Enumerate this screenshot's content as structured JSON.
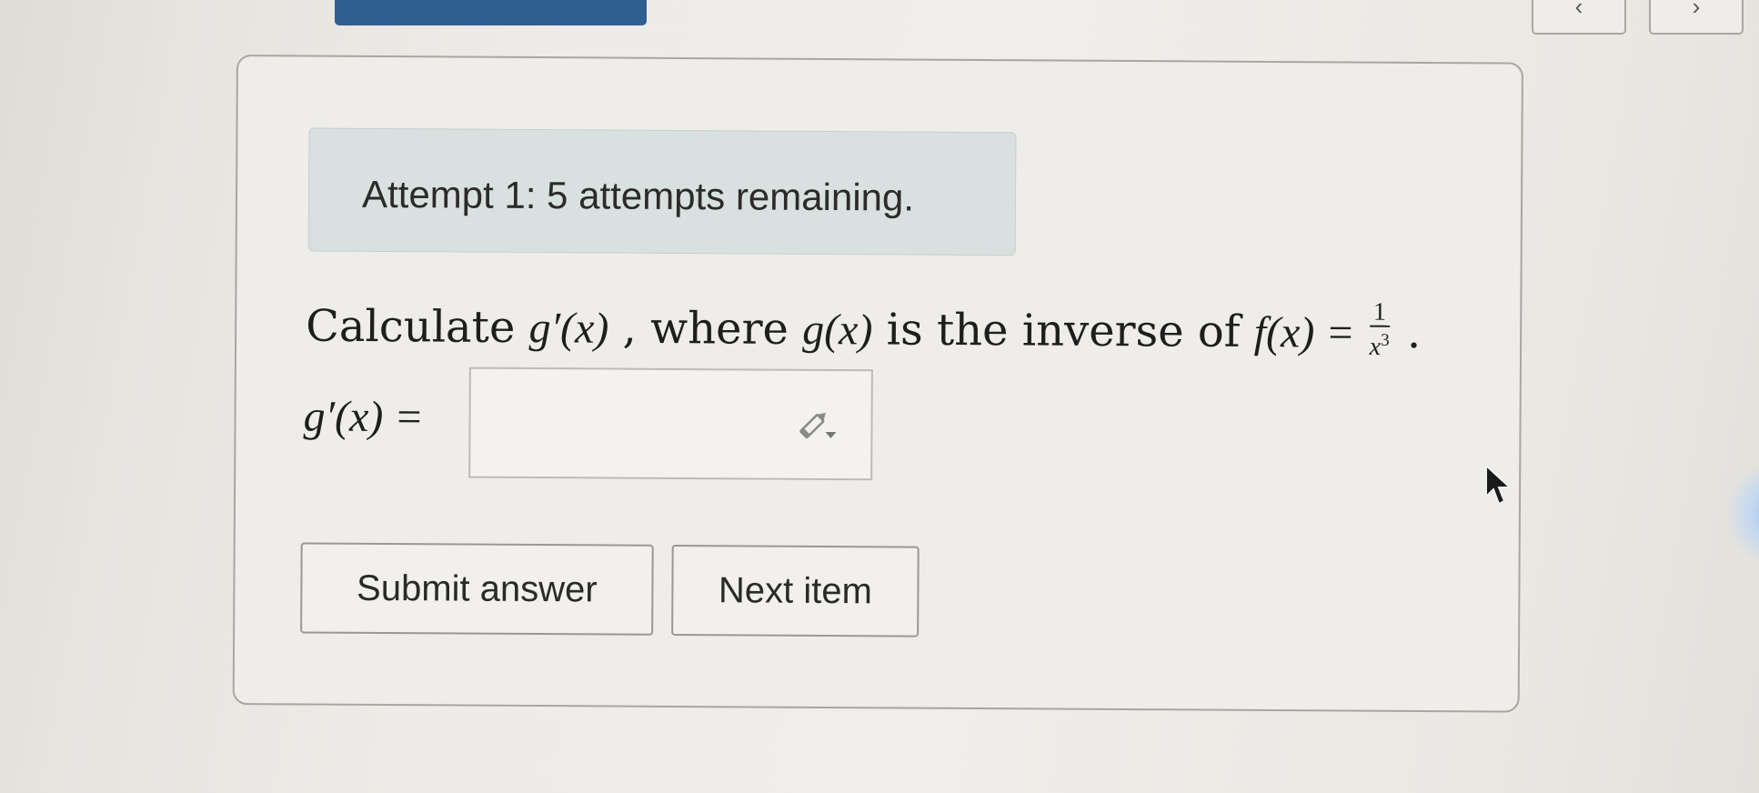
{
  "nav": {
    "prev_icon": "chevron-left-icon",
    "next_icon": "chevron-right-icon",
    "prev_glyph": "‹",
    "next_glyph": "›"
  },
  "attempt": {
    "text": "Attempt 1: 5 attempts remaining."
  },
  "question": {
    "prefix": "Calculate ",
    "deriv_fn": "g′(x)",
    "middle": ", where ",
    "inverse_fn": "g(x)",
    "middle2": " is the inverse of ",
    "fx": "f(x) = ",
    "frac_num": "1",
    "frac_den_base": "x",
    "frac_den_exp": "3",
    "suffix": "."
  },
  "answer": {
    "label": "g′(x) =",
    "value": "",
    "tool_icon": "pencil-icon"
  },
  "buttons": {
    "submit": "Submit answer",
    "next": "Next item"
  },
  "colors": {
    "top_button": "#2f5f90",
    "banner_bg": "#d9e1e0"
  }
}
